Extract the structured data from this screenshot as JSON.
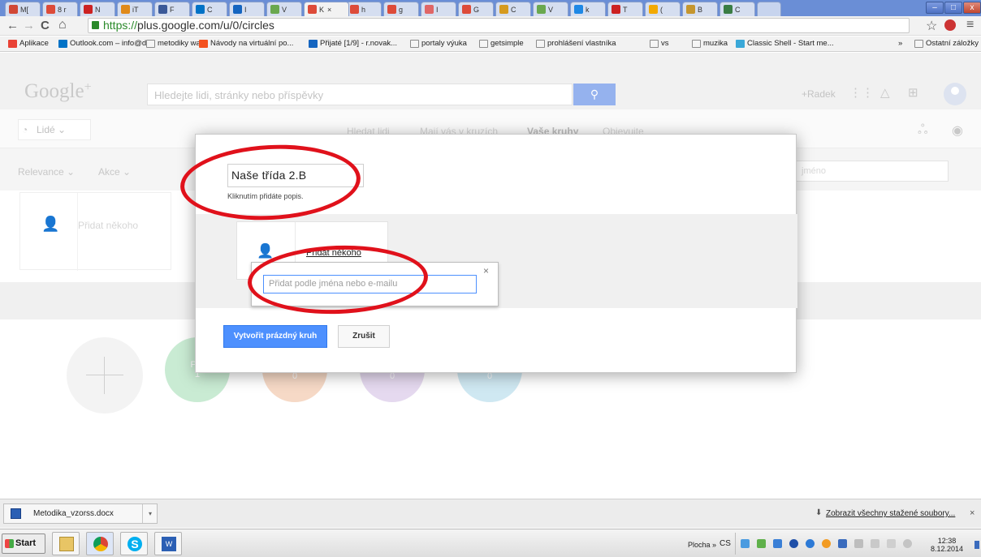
{
  "browser": {
    "tabs": [
      {
        "label": "M[",
        "color": "#d14836"
      },
      {
        "label": "8 r",
        "color": "#dd4b39"
      },
      {
        "label": "N",
        "color": "#cc2222"
      },
      {
        "label": "iT",
        "color": "#e08a1a"
      },
      {
        "label": "F",
        "color": "#3b5998"
      },
      {
        "label": "C",
        "color": "#0072c6"
      },
      {
        "label": "I",
        "color": "#1565c0"
      },
      {
        "label": "V",
        "color": "#6aa84f"
      },
      {
        "label": "K",
        "color": "#dd4b39"
      },
      {
        "label": "h",
        "color": "#dd4b39"
      },
      {
        "label": "g",
        "color": "#dd4b39"
      },
      {
        "label": "I",
        "color": "#e06666"
      },
      {
        "label": "G",
        "color": "#dd4b39"
      },
      {
        "label": "C",
        "color": "#d69b1f"
      },
      {
        "label": "V",
        "color": "#6aa84f"
      },
      {
        "label": "k",
        "color": "#1e88e5"
      },
      {
        "label": "T",
        "color": "#cc2222"
      },
      {
        "label": "(",
        "color": "#f2a900"
      },
      {
        "label": "B",
        "color": "#c5962e"
      },
      {
        "label": "C",
        "color": "#3a7d44"
      }
    ],
    "active_tab_close": "×",
    "window_buttons": {
      "minimize": "–",
      "maximize": "□",
      "close": "x"
    },
    "url_scheme": "https://",
    "url_rest": "plus.google.com/u/0/circles",
    "nav": {
      "back": "←",
      "forward": "→",
      "reload": "C",
      "home": "⌂",
      "star": "☆",
      "menu": "≡"
    },
    "bookmarks": [
      {
        "label": "Aplikace",
        "color": "#e94235"
      },
      {
        "label": "Outlook.com – info@d...",
        "color": "#0072c6"
      },
      {
        "label": "metodiky wa",
        "color": "folder"
      },
      {
        "label": "Návody na virtuální po...",
        "color": "#f4511e"
      },
      {
        "label": "Přijaté [1/9] - r.novak...",
        "color": "#1565c0"
      },
      {
        "label": "portaly výuka",
        "color": "folder"
      },
      {
        "label": "getsimple",
        "color": "folder"
      },
      {
        "label": "prohlášení vlastníka",
        "color": "folder"
      },
      {
        "label": "vs",
        "color": "folder"
      },
      {
        "label": "muzika",
        "color": "folder"
      },
      {
        "label": "Classic Shell - Start me...",
        "color": "#3aa8d8"
      }
    ],
    "bookmarks_overflow": "»",
    "other_bookmarks": "Ostatní záložky"
  },
  "gplus": {
    "logo": "Google",
    "logo_plus": "+",
    "search_placeholder": "Hledejte lidi, stránky nebo příspěvky",
    "search_icon": "🔍",
    "user_name": "+Radek",
    "people_dropdown": "Lidé",
    "subtabs": [
      "Hledat lidi",
      "Mají vás v kruzích",
      "Vaše kruhy",
      "Objevujte"
    ],
    "active_subtab": 2,
    "filters": [
      "Relevance",
      "Akce"
    ],
    "find_placeholder": "jméno",
    "bg_add_someone": "Přidat někoho",
    "circles": [
      {
        "label": "Přá",
        "count": "1",
        "color": "#c9ebd3"
      },
      {
        "label": "",
        "count": "0",
        "color": "#f6d9c6"
      },
      {
        "label": "",
        "count": "0",
        "color": "#e5d9ef"
      },
      {
        "label": "",
        "count": "0",
        "color": "#cfe8f2"
      }
    ]
  },
  "dialog": {
    "circle_name": "Naše třída 2.B",
    "add_description": "Kliknutím přidáte popis.",
    "add_someone": "Přidat někoho",
    "popup_placeholder": "Přidat podle jména nebo e-mailu",
    "popup_close": "×",
    "create_button": "Vytvořit prázdný kruh",
    "cancel_button": "Zrušit"
  },
  "downloads": {
    "file_name": "Metodika_vzorss.docx",
    "show_all": "Zobrazit všechny stažené soubory...",
    "close": "×"
  },
  "taskbar": {
    "start": "Start",
    "desktop": "Plocha",
    "overflow": "»",
    "language": "CS",
    "time": "12:38",
    "date": "8.12.2014"
  },
  "colors": {
    "accent_blue": "#4d90fe",
    "annotation_red": "#e0111b"
  }
}
